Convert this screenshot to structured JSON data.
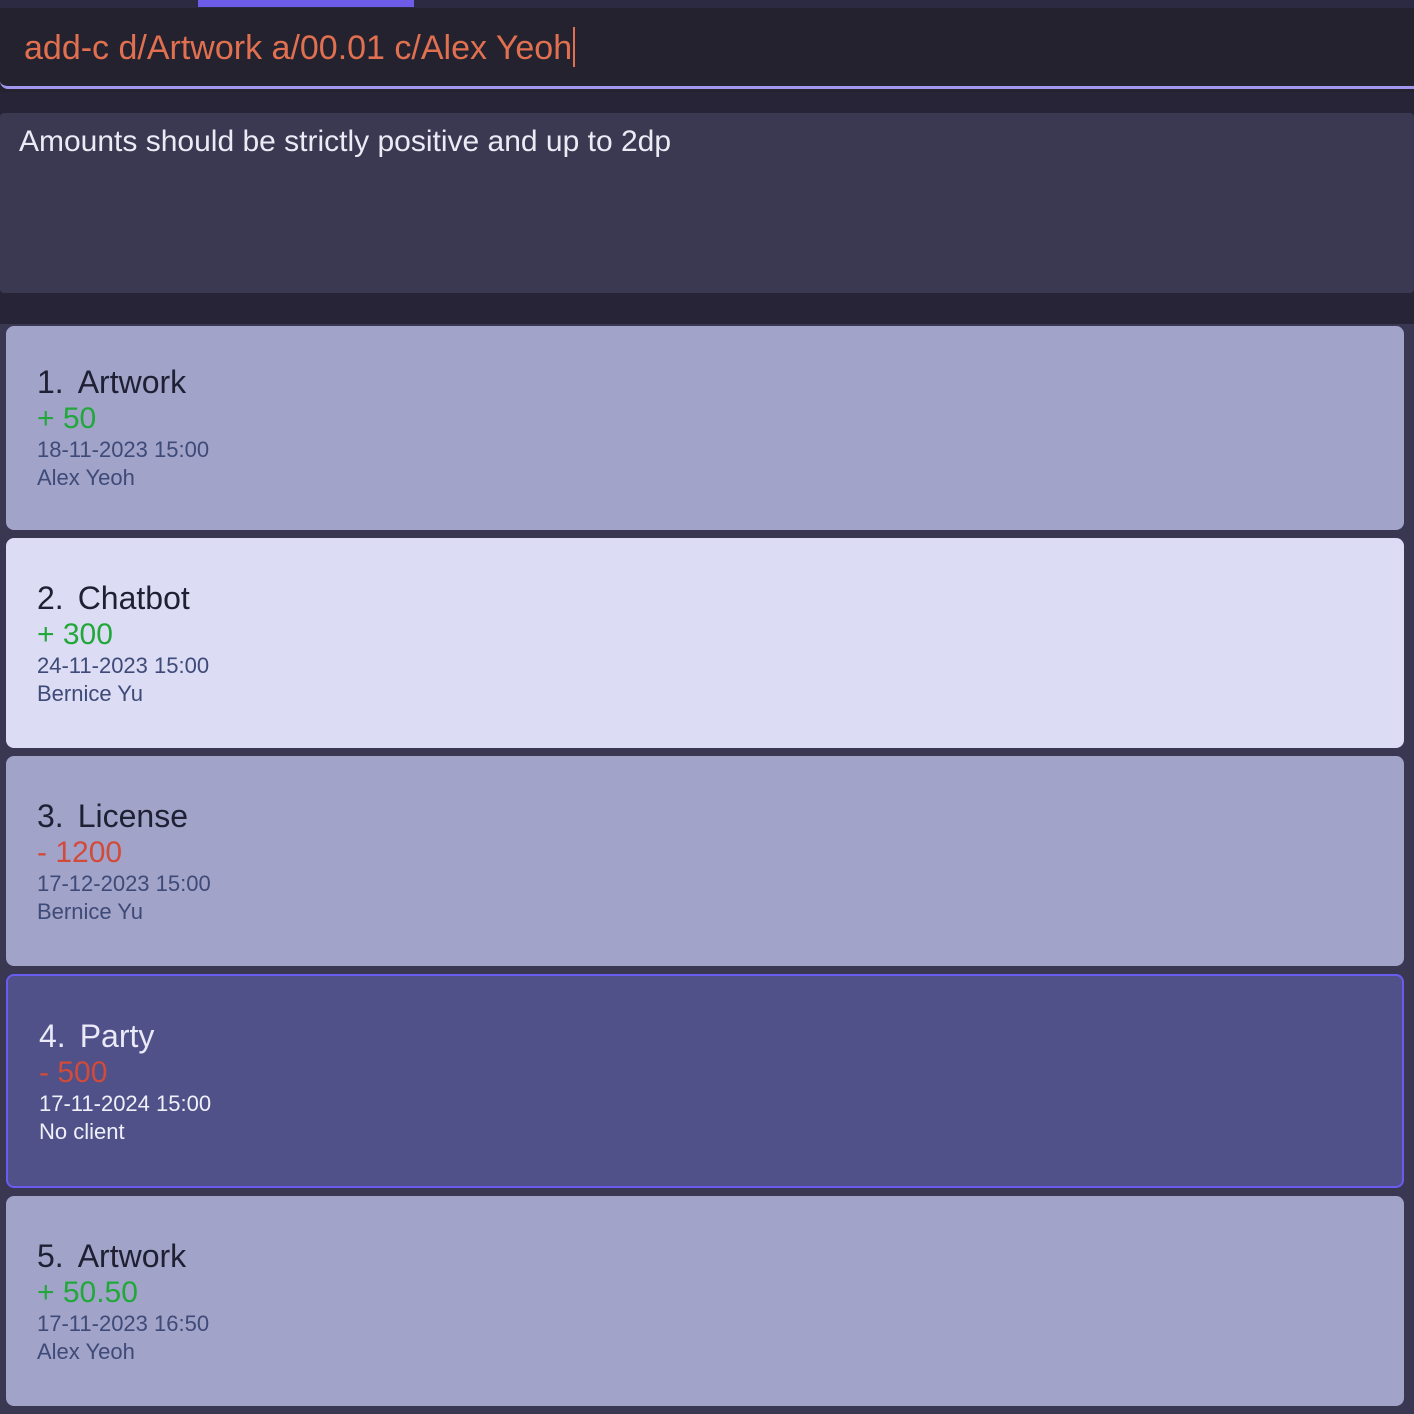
{
  "command": {
    "value": "add-c d/Artwork a/00.01 c/Alex Yeoh"
  },
  "result": {
    "message": "Amounts should be strictly positive and up to 2dp"
  },
  "transactions": [
    {
      "index": "1.",
      "description": "Artwork",
      "amount": "+ 50",
      "sign": "positive",
      "datetime": "18-11-2023 15:00",
      "client": "Alex Yeoh"
    },
    {
      "index": "2.",
      "description": "Chatbot",
      "amount": "+ 300",
      "sign": "positive",
      "datetime": "24-11-2023 15:00",
      "client": "Bernice Yu"
    },
    {
      "index": "3.",
      "description": "License",
      "amount": "- 1200",
      "sign": "negative",
      "datetime": "17-12-2023 15:00",
      "client": "Bernice Yu"
    },
    {
      "index": "4.",
      "description": "Party",
      "amount": "- 500",
      "sign": "negative",
      "datetime": "17-11-2024 15:00",
      "client": "No client"
    },
    {
      "index": "5.",
      "description": "Artwork",
      "amount": "+ 50.50",
      "sign": "positive",
      "datetime": "17-11-2023 16:50",
      "client": "Alex Yeoh"
    }
  ],
  "colors": {
    "accent": "#6c5ce7",
    "command_text": "#e0704f",
    "positive_amount": "#22a83a",
    "negative_amount": "#d24a3a",
    "card_default": "#a1a3c9",
    "card_hover": "#dcdcf4",
    "card_selected": "#4f5188"
  }
}
